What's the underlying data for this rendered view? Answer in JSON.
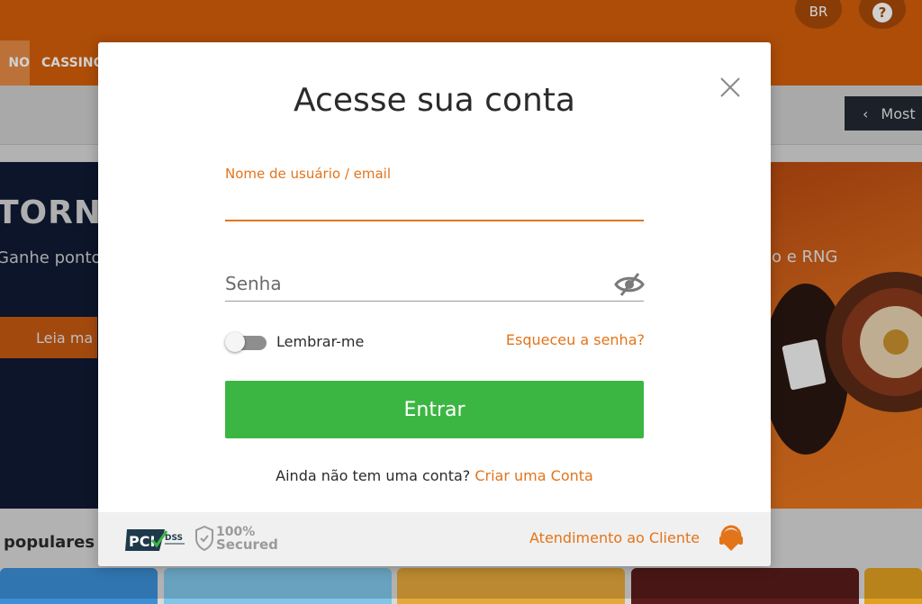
{
  "header": {
    "lang_label": "BR",
    "help_icon": "question-circle-icon",
    "nav_tabs": [
      {
        "label": "NO"
      },
      {
        "label": "CASSINO"
      }
    ]
  },
  "subbar": {
    "show_button_label": "Most"
  },
  "banner": {
    "title": "TORNI",
    "subtitle": "Ganhe ponto",
    "subtitle_right": "o e RNG",
    "button_label": "Leia ma"
  },
  "popular": {
    "heading": "populares"
  },
  "modal": {
    "title": "Acesse sua conta",
    "username_label": "Nome de usuário / email",
    "username_value": "",
    "password_placeholder": "Senha",
    "remember_label": "Lembrar-me",
    "forgot_label": "Esqueceu a senha?",
    "submit_label": "Entrar",
    "signup_prompt": "Ainda não tem uma conta?",
    "signup_link": "Criar uma Conta",
    "footer": {
      "pci_text": "PCI",
      "dss_text": "DSS",
      "secured_percent": "100%",
      "secured_text": "Secured",
      "support_label": "Atendimento ao Cliente"
    }
  },
  "colors": {
    "brand_orange": "#e3741a",
    "header_orange": "#d35e0a",
    "submit_green": "#3cb643"
  }
}
